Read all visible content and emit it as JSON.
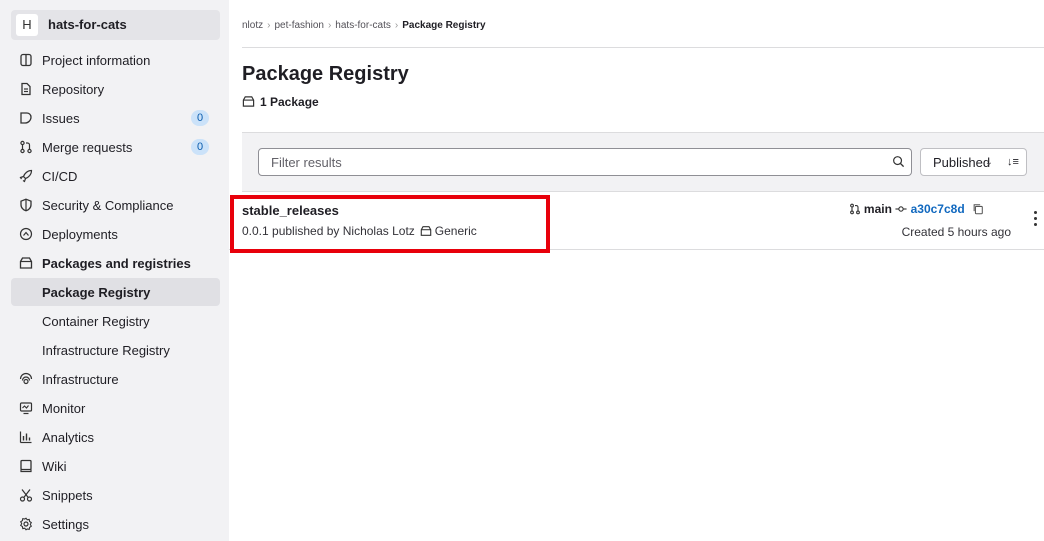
{
  "project": {
    "avatar_letter": "H",
    "name": "hats-for-cats"
  },
  "sidebar": {
    "items": [
      {
        "label": "Project information",
        "icon": "info-icon"
      },
      {
        "label": "Repository",
        "icon": "doc-icon"
      },
      {
        "label": "Issues",
        "icon": "issues-icon",
        "badge": "0"
      },
      {
        "label": "Merge requests",
        "icon": "merge-request-icon",
        "badge": "0"
      },
      {
        "label": "CI/CD",
        "icon": "rocket-icon"
      },
      {
        "label": "Security & Compliance",
        "icon": "shield-icon"
      },
      {
        "label": "Deployments",
        "icon": "deployments-icon"
      },
      {
        "label": "Packages and registries",
        "icon": "package-icon"
      },
      {
        "label": "Package Registry"
      },
      {
        "label": "Container Registry"
      },
      {
        "label": "Infrastructure Registry"
      },
      {
        "label": "Infrastructure",
        "icon": "cloud-gear-icon"
      },
      {
        "label": "Monitor",
        "icon": "monitor-icon"
      },
      {
        "label": "Analytics",
        "icon": "chart-icon"
      },
      {
        "label": "Wiki",
        "icon": "book-icon"
      },
      {
        "label": "Snippets",
        "icon": "scissors-icon"
      },
      {
        "label": "Settings",
        "icon": "gear-icon"
      }
    ]
  },
  "breadcrumb": [
    "nlotz",
    "pet-fashion",
    "hats-for-cats",
    "Package Registry"
  ],
  "page": {
    "title": "Package Registry",
    "count": "1 Package"
  },
  "filter": {
    "placeholder": "Filter results",
    "sort_label": "Published",
    "sort_dir": "↓≡"
  },
  "package": {
    "name": "stable_releases",
    "meta": "0.0.1 published by Nicholas Lotz",
    "type": "Generic",
    "branch": "main",
    "commit": "a30c7c8d",
    "created": "Created 5 hours ago"
  },
  "colors": {
    "accent": "#1068bf",
    "highlight": "#e8000b",
    "badge_bg": "#cbe2f9"
  }
}
